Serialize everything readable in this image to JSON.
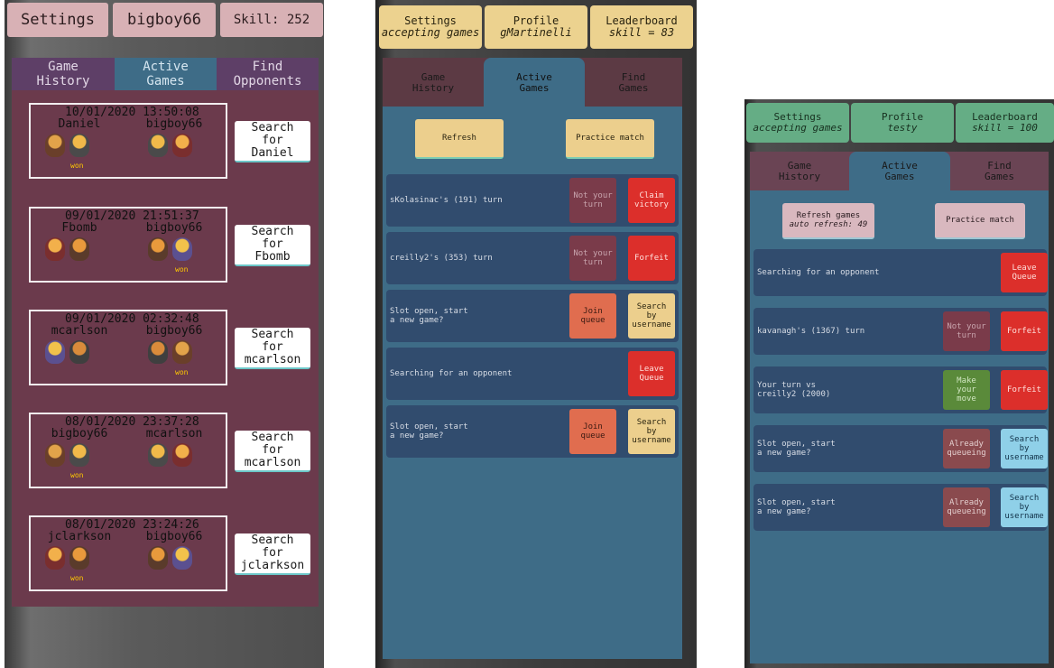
{
  "panel1": {
    "header": {
      "settings": "Settings",
      "username": "bigboy66",
      "skill": "Skill: 252"
    },
    "tabs": [
      "Game\nHistory",
      "Active\nGames",
      "Find\nOpponents"
    ],
    "tab_lines": [
      [
        "Game",
        "History"
      ],
      [
        "Active",
        "Games"
      ],
      [
        "Find",
        "Opponents"
      ]
    ],
    "won_label": "won",
    "games": [
      {
        "datetime": "10/01/2020 13:50:08",
        "left": "Daniel",
        "right": "bigboy66",
        "winner": "left",
        "search": [
          "Search",
          "for",
          "Daniel"
        ]
      },
      {
        "datetime": "09/01/2020 21:51:37",
        "left": "Fbomb",
        "right": "bigboy66",
        "winner": "right",
        "search": [
          "Search",
          "for",
          "Fbomb"
        ]
      },
      {
        "datetime": "09/01/2020 02:32:48",
        "left": "mcarlson",
        "right": "bigboy66",
        "winner": "right",
        "search": [
          "Search",
          "for",
          "mcarlson"
        ]
      },
      {
        "datetime": "08/01/2020 23:37:28",
        "left": "bigboy66",
        "right": "mcarlson",
        "winner": "left",
        "search": [
          "Search",
          "for",
          "mcarlson"
        ]
      },
      {
        "datetime": "08/01/2020 23:24:26",
        "left": "jclarkson",
        "right": "bigboy66",
        "winner": "left",
        "search": [
          "Search",
          "for",
          "jclarkson"
        ]
      }
    ]
  },
  "panel2": {
    "header": [
      {
        "title": "Settings",
        "sub": "accepting games"
      },
      {
        "title": "Profile",
        "sub": "gMartinelli"
      },
      {
        "title": "Leaderboard",
        "sub": "skill = 83"
      }
    ],
    "tabs": [
      [
        "Game",
        "History"
      ],
      [
        "Active",
        "Games"
      ],
      [
        "Find",
        "Games"
      ]
    ],
    "refresh": "Refresh",
    "practice": "Practice match",
    "rows": [
      {
        "text": [
          "sKolasinac's (191) turn"
        ],
        "buttons": [
          {
            "lines": [
              "Not your",
              "turn"
            ],
            "style": "notyour"
          },
          {
            "lines": [
              "Claim",
              "victory"
            ],
            "style": "red"
          }
        ]
      },
      {
        "text": [
          "creilly2's (353) turn"
        ],
        "buttons": [
          {
            "lines": [
              "Not your",
              "turn"
            ],
            "style": "notyour"
          },
          {
            "lines": [
              "Forfeit"
            ],
            "style": "red"
          }
        ]
      },
      {
        "text": [
          "Slot open, start",
          "a new game?"
        ],
        "buttons": [
          {
            "lines": [
              "Join",
              "queue"
            ],
            "style": "join"
          },
          {
            "lines": [
              "Search",
              "by",
              "username"
            ],
            "style": "yellow"
          }
        ]
      },
      {
        "text": [
          "Searching for an opponent"
        ],
        "buttons": [
          {
            "lines": [
              "Leave",
              "Queue"
            ],
            "style": "red"
          }
        ]
      },
      {
        "text": [
          "Slot open, start",
          "a new game?"
        ],
        "buttons": [
          {
            "lines": [
              "Join",
              "queue"
            ],
            "style": "join"
          },
          {
            "lines": [
              "Search",
              "by",
              "username"
            ],
            "style": "yellow"
          }
        ]
      }
    ]
  },
  "panel3": {
    "header": [
      {
        "title": "Settings",
        "sub": "accepting games"
      },
      {
        "title": "Profile",
        "sub": "testy"
      },
      {
        "title": "Leaderboard",
        "sub": "skill = 100"
      }
    ],
    "tabs": [
      [
        "Game",
        "History"
      ],
      [
        "Active",
        "Games"
      ],
      [
        "Find",
        "Games"
      ]
    ],
    "refresh": {
      "title": "Refresh games",
      "sub": "auto refresh: 49"
    },
    "practice": "Practice match",
    "rows": [
      {
        "text": [
          "Searching for an opponent"
        ],
        "buttons": [
          {
            "lines": [
              "Leave",
              "Queue"
            ],
            "style": "red"
          }
        ]
      },
      {
        "text": [
          "kavanagh's (1367) turn"
        ],
        "buttons": [
          {
            "lines": [
              "Not your",
              "turn"
            ],
            "style": "notyour"
          },
          {
            "lines": [
              "Forfeit"
            ],
            "style": "red"
          }
        ]
      },
      {
        "text": [
          "Your turn vs",
          "creilly2 (2000)"
        ],
        "buttons": [
          {
            "lines": [
              "Make",
              "your",
              "move"
            ],
            "style": "green"
          },
          {
            "lines": [
              "Forfeit"
            ],
            "style": "red"
          }
        ]
      },
      {
        "text": [
          "Slot open, start",
          "a new game?"
        ],
        "buttons": [
          {
            "lines": [
              "Already",
              "queueing"
            ],
            "style": "already"
          },
          {
            "lines": [
              "Search",
              "by",
              "username"
            ],
            "style": "blue"
          }
        ]
      },
      {
        "text": [
          "Slot open, start",
          "a new game?"
        ],
        "buttons": [
          {
            "lines": [
              "Already",
              "queueing"
            ],
            "style": "already"
          },
          {
            "lines": [
              "Search",
              "by",
              "username"
            ],
            "style": "blue"
          }
        ]
      }
    ]
  },
  "colors": {
    "panel1_body": "#6b3a4c",
    "panel1_header": "#d8b1b5",
    "panel2_header": "#ecd28f",
    "panel3_header": "#65ad85",
    "active_tab": "#3e6c87",
    "row": "#314c6e",
    "won": "#ffc800"
  },
  "icons": [
    "character-avatar-icon"
  ]
}
